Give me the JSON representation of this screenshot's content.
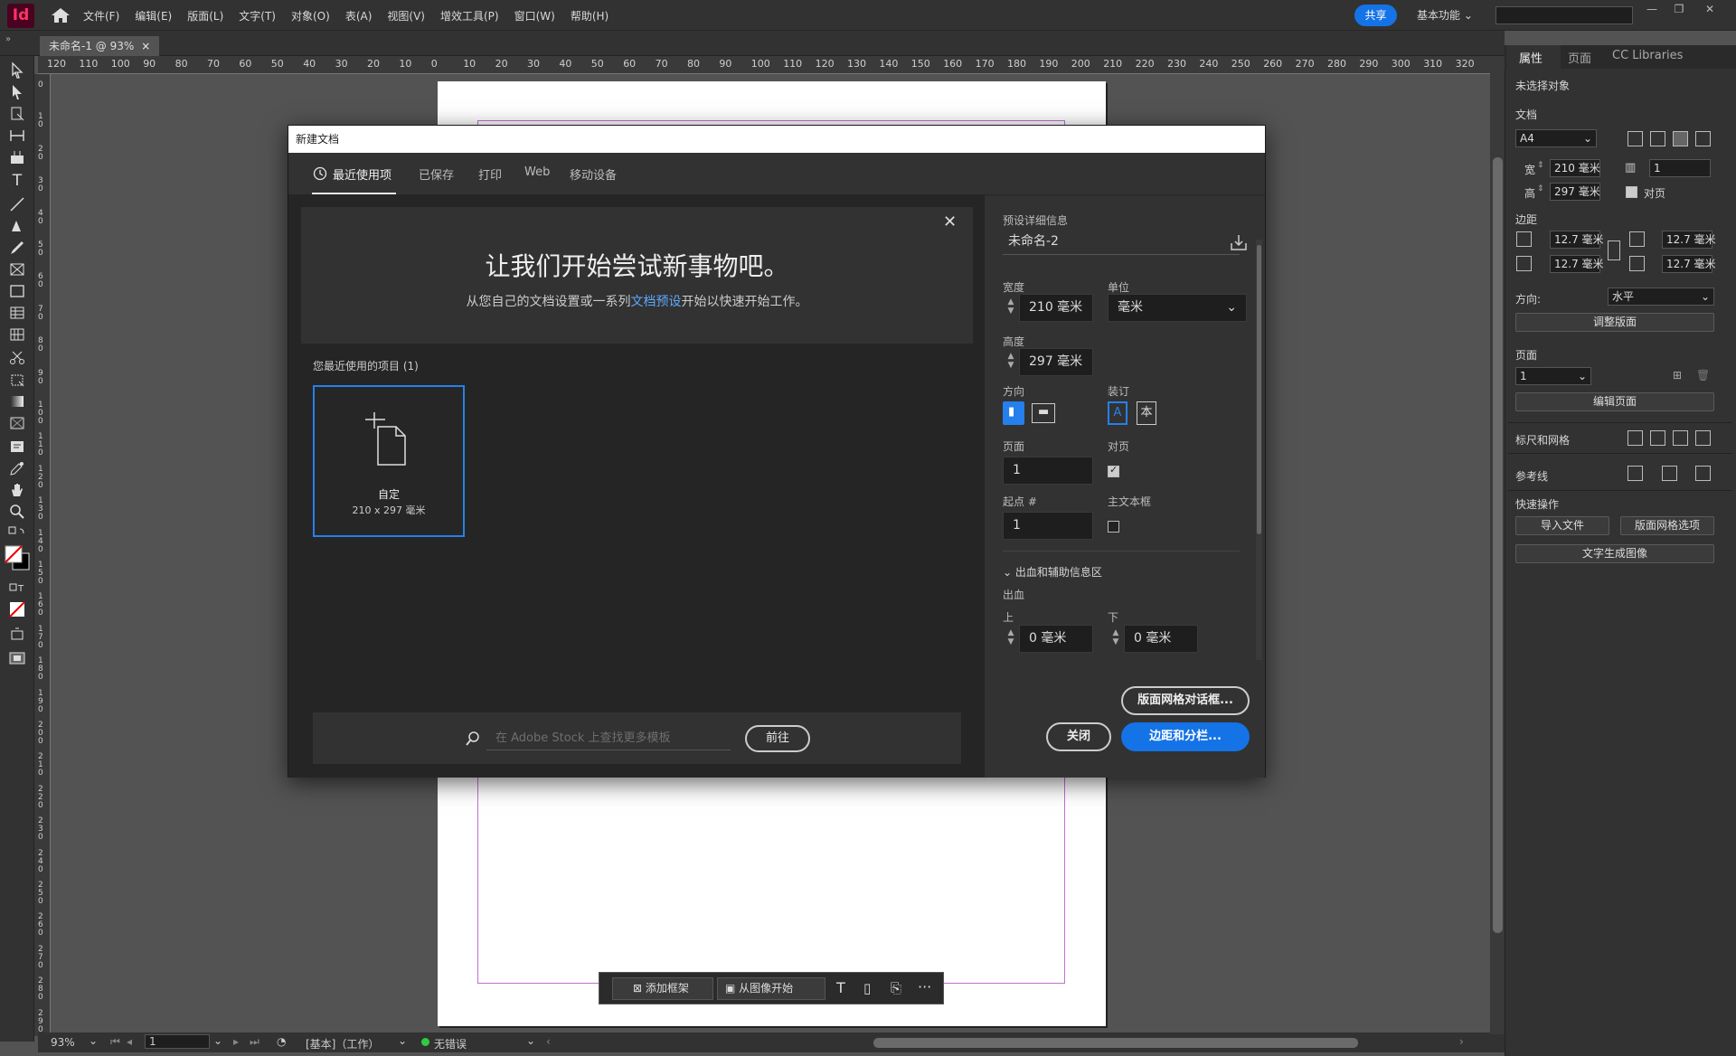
{
  "app": {
    "logo": "Id",
    "menu": [
      "文件(F)",
      "编辑(E)",
      "版面(L)",
      "文字(T)",
      "对象(O)",
      "表(A)",
      "视图(V)",
      "增效工具(P)",
      "窗口(W)",
      "帮助(H)"
    ],
    "share": "共享",
    "workspace": "基本功能",
    "doc_tab": "未命名-1 @ 93%",
    "doc_tab_close": "×"
  },
  "ruler": {
    "h_ticks": [
      "120",
      "110",
      "100",
      "90",
      "80",
      "70",
      "60",
      "50",
      "40",
      "30",
      "20",
      "10",
      "0",
      "10",
      "20",
      "30",
      "40",
      "50",
      "60",
      "70",
      "80",
      "90",
      "100",
      "110",
      "120",
      "130",
      "140",
      "150",
      "160",
      "170",
      "180",
      "190",
      "200",
      "210",
      "220",
      "230",
      "240",
      "250",
      "260",
      "270",
      "280",
      "290",
      "300",
      "310",
      "320"
    ],
    "v_ticks": [
      "0",
      "1 0",
      "2 0",
      "3 0",
      "4 0",
      "5 0",
      "6 0",
      "7 0",
      "8 0",
      "9 0",
      "1 0 0",
      "1 1 0",
      "1 2 0",
      "1 3 0",
      "1 4 0",
      "1 5 0",
      "1 6 0",
      "1 7 0",
      "1 8 0",
      "1 9 0",
      "2 0 0",
      "2 1 0",
      "2 2 0",
      "2 3 0",
      "2 4 0",
      "2 5 0",
      "2 6 0",
      "2 7 0",
      "2 8 0",
      "2 9 0"
    ]
  },
  "status": {
    "zoom": "93%",
    "page": "1",
    "style": "[基本]（工作）",
    "preflight": "无错误"
  },
  "context_bar": {
    "add_frame": "添加框架",
    "from_image": "从图像开始"
  },
  "properties": {
    "tabs": [
      "属性",
      "页面",
      "CC Libraries"
    ],
    "no_selection": "未选择对象",
    "document_label": "文档",
    "preset": "A4",
    "width_label": "宽",
    "width": "210 毫米",
    "height_label": "高",
    "height": "297 毫米",
    "pages_count": "1",
    "facing_pages": "对页",
    "margins_label": "边距",
    "margin_top": "12.7 毫米",
    "margin_bottom": "12.7 毫米",
    "margin_left": "12.7 毫米",
    "margin_right": "12.7 毫米",
    "orientation_label": "方向:",
    "orientation": "水平",
    "adjust_layout": "调整版面",
    "page_label": "页面",
    "page_value": "1",
    "edit_page": "编辑页面",
    "rulers_grid": "标尺和网格",
    "guides": "参考线",
    "quick_actions": "快速操作",
    "import_file": "导入文件",
    "layout_grid": "版面网格选项",
    "text_to_image": "文字生成图像"
  },
  "dialog": {
    "title": "新建文档",
    "tabs": [
      "最近使用项",
      "已保存",
      "打印",
      "Web",
      "移动设备"
    ],
    "welcome_title": "让我们开始尝试新事物吧。",
    "welcome_sub_pre": "从您自己的文档设置或一系列",
    "welcome_sub_link": "文档预设",
    "welcome_sub_post": "开始以快速开始工作。",
    "recent_label": "您最近使用的项目 (1)",
    "recent_item_name": "自定",
    "recent_item_size": "210 x 297 毫米",
    "stock_placeholder": "在 Adobe Stock 上查找更多模板",
    "goto": "前往",
    "preset_details": "预设详细信息",
    "doc_name": "未命名-2",
    "width_label": "宽度",
    "width": "210 毫米",
    "unit_label": "单位",
    "unit": "毫米",
    "height_label": "高度",
    "height": "297 毫米",
    "orientation_label": "方向",
    "binding_label": "装订",
    "pages_label": "页面",
    "pages": "1",
    "facing_label": "对页",
    "start_label": "起点 #",
    "start": "1",
    "primary_frame_label": "主文本框",
    "bleed_section": "出血和辅助信息区",
    "bleed_label": "出血",
    "top_label": "上",
    "top": "0 毫米",
    "bottom_label": "下",
    "bottom": "0 毫米",
    "grid_dialog": "版面网格对话框...",
    "close": "关闭",
    "margins_columns": "边距和分栏..."
  },
  "colors": {
    "accent": "#1473e6",
    "ui_dark": "#323232",
    "canvas": "#535353",
    "margin_guide": "#c070d0"
  }
}
